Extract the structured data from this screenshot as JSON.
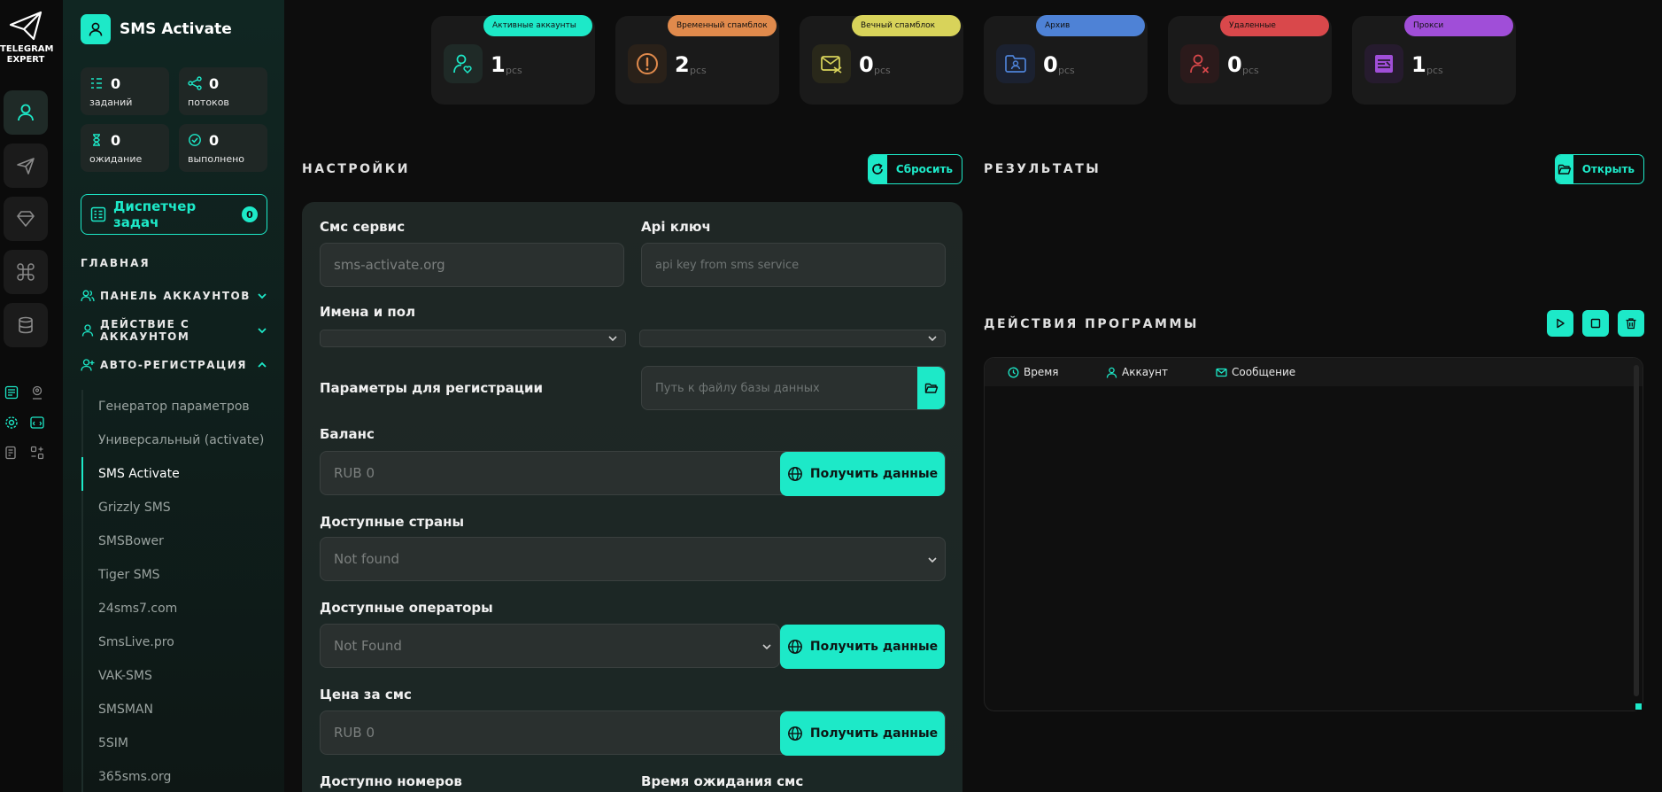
{
  "brand": {
    "line1": "TELEGRAM",
    "line2": "EXPERT"
  },
  "app": {
    "title": "SMS Activate"
  },
  "stats": [
    {
      "value": "0",
      "label": "заданий",
      "icon": "tasks-icon"
    },
    {
      "value": "0",
      "label": "потоков",
      "icon": "threads-icon"
    },
    {
      "value": "0",
      "label": "ожидание",
      "icon": "hourglass-icon"
    },
    {
      "value": "0",
      "label": "выполнено",
      "icon": "check-icon"
    }
  ],
  "task_manager": {
    "label": "Диспетчер задач",
    "count": "0"
  },
  "nav": {
    "section": "ГЛАВНАЯ",
    "groups": [
      {
        "label": "ПАНЕЛЬ АККАУНТОВ"
      },
      {
        "label": "ДЕЙСТВИЕ С АККАУНТОМ"
      },
      {
        "label": "АВТО-РЕГИСТРАЦИЯ"
      }
    ],
    "sub_items": [
      {
        "label": "Генератор параметров"
      },
      {
        "label": "Универсальный (activate)"
      },
      {
        "label": "SMS Activate"
      },
      {
        "label": "Grizzly SMS"
      },
      {
        "label": "SMSBower"
      },
      {
        "label": "Tiger SMS"
      },
      {
        "label": "24sms7.com"
      },
      {
        "label": "SmsLive.pro"
      },
      {
        "label": "VAK-SMS"
      },
      {
        "label": "SMSMAN"
      },
      {
        "label": "5SIM"
      },
      {
        "label": "365sms.org"
      }
    ],
    "active_index": 2
  },
  "cards": [
    {
      "tag": "Активные аккаунты",
      "value": "1",
      "unit": "pcs",
      "color": "#1de9c8"
    },
    {
      "tag": "Временный спамблок",
      "value": "2",
      "unit": "pcs",
      "color": "#e08a4c"
    },
    {
      "tag": "Вечный спамблок",
      "value": "0",
      "unit": "pcs",
      "color": "#d8d35a"
    },
    {
      "tag": "Архив",
      "value": "0",
      "unit": "pcs",
      "color": "#4e82d6"
    },
    {
      "tag": "Удаленные",
      "value": "0",
      "unit": "pcs",
      "color": "#d9484b"
    },
    {
      "tag": "Прокси",
      "value": "1",
      "unit": "pcs",
      "color": "#a04ed8"
    }
  ],
  "settings": {
    "title": "НАСТРОЙКИ",
    "reset_label": "Сбросить",
    "sms_service_label": "Смс сервис",
    "sms_service_value": "sms-activate.org",
    "api_key_label": "Api ключ",
    "api_key_placeholder": "api key from sms service",
    "names_label": "Имена и пол",
    "reg_params_label": "Параметры для регистрации",
    "db_path_placeholder": "Путь к файлу базы данных",
    "balance_label": "Баланс",
    "balance_value": "RUB   0",
    "get_data_label": "Получить данные",
    "countries_label": "Доступные страны",
    "countries_value": "Not found",
    "operators_label": "Доступные операторы",
    "operators_value": "Not Found",
    "price_label": "Цена за смс",
    "price_value": "RUB   0",
    "numbers_label": "Доступно номеров",
    "wait_label": "Время ожидания смс"
  },
  "results": {
    "title": "РЕЗУЛЬТАТЫ",
    "open_label": "Открыть"
  },
  "actions": {
    "title": "ДЕЙСТВИЯ ПРОГРАММЫ",
    "columns": {
      "time": "Время",
      "account": "Аккаунт",
      "message": "Сообщение"
    }
  },
  "accent": "#1de9c8"
}
